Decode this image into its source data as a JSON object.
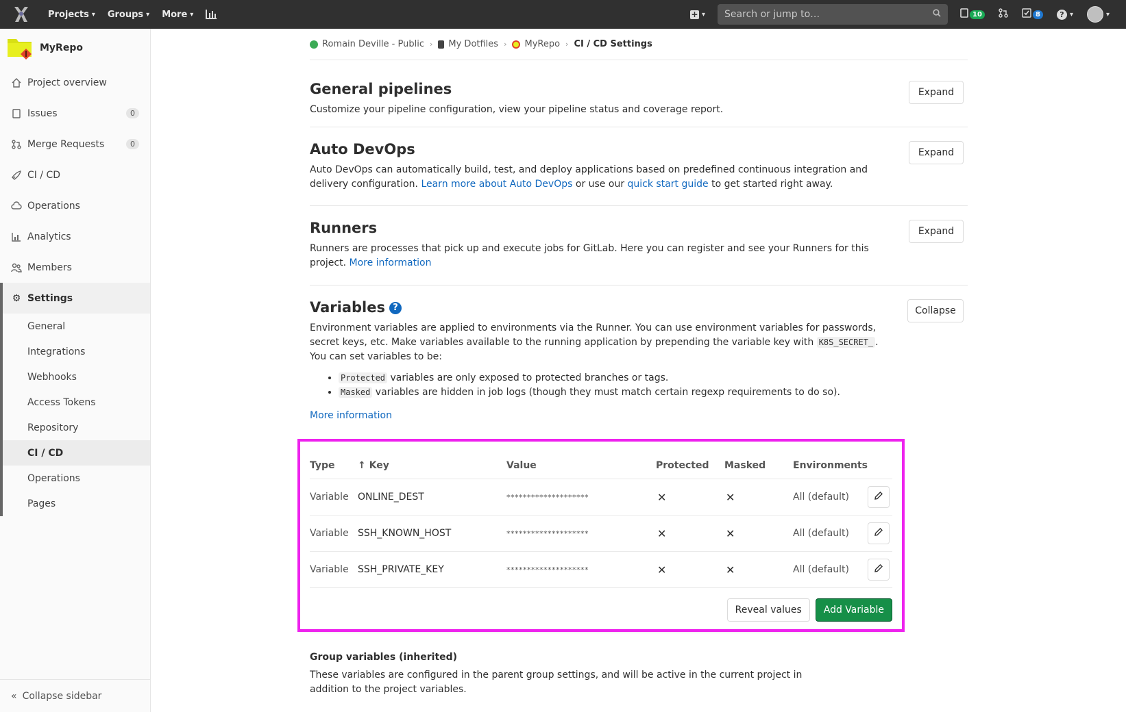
{
  "topnav": {
    "projects": "Projects",
    "groups": "Groups",
    "more": "More",
    "search_placeholder": "Search or jump to…",
    "issues_count": "10",
    "todos_count": "8"
  },
  "sidebar": {
    "project_name": "MyRepo",
    "items": [
      {
        "label": "Project overview"
      },
      {
        "label": "Issues",
        "count": "0"
      },
      {
        "label": "Merge Requests",
        "count": "0"
      },
      {
        "label": "CI / CD"
      },
      {
        "label": "Operations"
      },
      {
        "label": "Analytics"
      },
      {
        "label": "Members"
      }
    ],
    "settings_label": "Settings",
    "settings_items": [
      {
        "label": "General"
      },
      {
        "label": "Integrations"
      },
      {
        "label": "Webhooks"
      },
      {
        "label": "Access Tokens"
      },
      {
        "label": "Repository"
      },
      {
        "label": "CI / CD"
      },
      {
        "label": "Operations"
      },
      {
        "label": "Pages"
      }
    ],
    "collapse_label": "Collapse sidebar"
  },
  "breadcrumb": [
    "Romain Deville - Public",
    "My Dotfiles",
    "MyRepo",
    "CI / CD Settings"
  ],
  "sections": {
    "general": {
      "title": "General pipelines",
      "desc": "Customize your pipeline configuration, view your pipeline status and coverage report.",
      "button": "Expand"
    },
    "autodevops": {
      "title": "Auto DevOps",
      "desc_a": "Auto DevOps can automatically build, test, and deploy applications based on predefined continuous integration and delivery configuration. ",
      "link1": "Learn more about Auto DevOps",
      "desc_b": " or use our ",
      "link2": "quick start guide",
      "desc_c": " to get started right away.",
      "button": "Expand"
    },
    "runners": {
      "title": "Runners",
      "desc": "Runners are processes that pick up and execute jobs for GitLab. Here you can register and see your Runners for this project. ",
      "link": "More information",
      "button": "Expand"
    },
    "variables": {
      "title": "Variables",
      "desc_a": "Environment variables are applied to environments via the Runner. You can use environment variables for passwords, secret keys, etc. Make variables available to the running application by prepending the variable key with ",
      "code_prefix": "K8S_SECRET_",
      "desc_b": ". You can set variables to be:",
      "bullet1_code": "Protected",
      "bullet1_text": " variables are only exposed to protected branches or tags.",
      "bullet2_code": "Masked",
      "bullet2_text": " variables are hidden in job logs (though they must match certain regexp requirements to do so).",
      "more_link": "More information",
      "button": "Collapse"
    }
  },
  "variables_table": {
    "headers": {
      "type": "Type",
      "key": "↑ Key",
      "value": "Value",
      "protected": "Protected",
      "masked": "Masked",
      "environments": "Environments"
    },
    "rows": [
      {
        "type": "Variable",
        "key": "ONLINE_DEST",
        "value": "********************",
        "protected": "✕",
        "masked": "✕",
        "env": "All (default)"
      },
      {
        "type": "Variable",
        "key": "SSH_KNOWN_HOST",
        "value": "********************",
        "protected": "✕",
        "masked": "✕",
        "env": "All (default)"
      },
      {
        "type": "Variable",
        "key": "SSH_PRIVATE_KEY",
        "value": "********************",
        "protected": "✕",
        "masked": "✕",
        "env": "All (default)"
      }
    ],
    "reveal_button": "Reveal values",
    "add_button": "Add Variable"
  },
  "group_variables": {
    "title": "Group variables (inherited)",
    "desc": "These variables are configured in the parent group settings, and will be active in the current project in addition to the project variables."
  },
  "colors": {
    "highlight": "#ee22ee",
    "primary_green": "#168f48",
    "link_blue": "#1068bf"
  }
}
